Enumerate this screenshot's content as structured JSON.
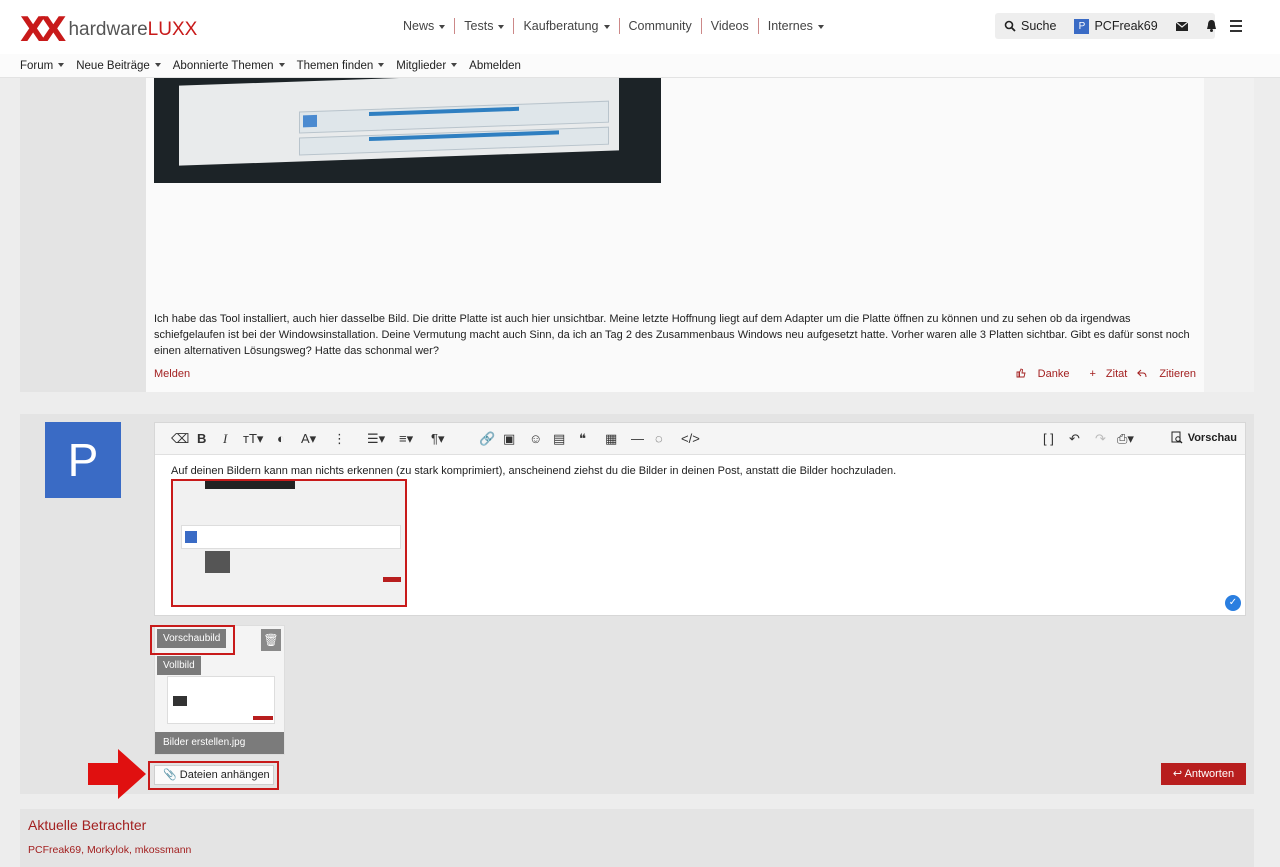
{
  "site": {
    "logo_mark": "XX",
    "logo_text_a": "hardware",
    "logo_text_b": "LUXX"
  },
  "topnav": [
    {
      "label": "News",
      "dropdown": true
    },
    {
      "label": "Tests",
      "dropdown": true
    },
    {
      "label": "Kaufberatung",
      "dropdown": true
    },
    {
      "label": "Community",
      "dropdown": false
    },
    {
      "label": "Videos",
      "dropdown": false
    },
    {
      "label": "Internes",
      "dropdown": true
    }
  ],
  "user": {
    "search_label": "Suche",
    "name": "PCFreak69",
    "avatar_letter": "P"
  },
  "subnav": [
    "Forum",
    "Neue Beiträge",
    "Abonnierte Themen",
    "Themen finden",
    "Mitglieder",
    "Abmelden"
  ],
  "post": {
    "text": "Ich habe das Tool installiert, auch hier dasselbe Bild. Die dritte Platte ist auch hier unsichtbar. Meine letzte Hoffnung liegt auf dem Adapter um die Platte öffnen zu können und zu sehen ob da irgendwas schiefgelaufen ist bei der Windowsinstallation. Deine Vermutung macht auch Sinn, da ich an Tag 2 des Zusammenbaus Windows neu aufgesetzt hatte. Vorher waren alle 3 Platten sichtbar. Gibt es dafür sonst noch einen alternativen Lösungsweg? Hatte das schonmal wer?",
    "report_label": "Melden",
    "like_label": "Danke",
    "quote_label": "Zitat",
    "reply_label": "Zitieren"
  },
  "editor": {
    "avatar_letter": "P",
    "preview_label": "Vorschau",
    "content_text": "Auf deinen Bildern kann man nichts erkennen (zu stark komprimiert), anscheinend ziehst du die Bilder in deinen Post, anstatt die Bilder hochzuladen.",
    "attachment": {
      "filename": "Bilder erstellen.jpg",
      "thumb_label": "Vorschaubild",
      "full_label": "Vollbild"
    },
    "attach_button": "Dateien anhängen",
    "submit_button": "Antworten"
  },
  "viewers": {
    "title": "Aktuelle Betrachter",
    "list": "PCFreak69, Morkylok, mkossmann"
  },
  "colors": {
    "brand": "#c81a1a",
    "link": "#a32020",
    "avatar": "#3a6bc5"
  }
}
